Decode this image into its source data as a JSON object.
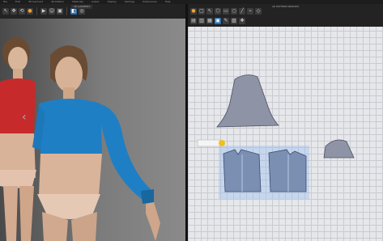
{
  "menu": {
    "items": [
      "File",
      "Edit",
      "3D Garment",
      "2D Pattern",
      "Materials",
      "Avatar",
      "Display",
      "Settings",
      "Preferences",
      "Help"
    ]
  },
  "viewport3d": {
    "tab_label": "3D GARMENT"
  },
  "viewport2d": {
    "tab_label": "2D PATTERN WINDOW"
  },
  "colors": {
    "top_blue": "#1f7fc4",
    "top_red": "#c62a2a",
    "pattern_fill": "#8f93a6",
    "pattern_stroke": "#4c5063",
    "selected_glow": "#9fc2f0",
    "pin_accent": "#f0c020"
  },
  "icons": {
    "toolbar3d": [
      "select-icon",
      "move-icon",
      "fold-icon",
      "pin-icon",
      "simulate-icon",
      "avatar-icon",
      "lock-icon",
      "view-icon"
    ],
    "toolbar2d": [
      "transform-icon",
      "edit-point-icon",
      "curve-icon",
      "polygon-icon",
      "rectangle-icon",
      "circle-icon",
      "internal-line-icon",
      "sewing-icon"
    ]
  }
}
